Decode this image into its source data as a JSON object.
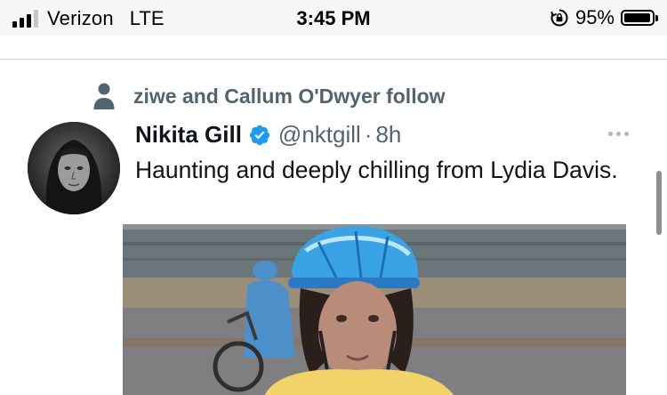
{
  "status_bar": {
    "carrier": "Verizon",
    "network": "LTE",
    "time": "3:45 PM",
    "battery_percent": "95%",
    "battery_level": 0.95,
    "signal_bars": 3
  },
  "social_context": {
    "text": "ziwe and Callum O'Dwyer follow",
    "icon": "person-icon"
  },
  "tweet": {
    "author_name": "Nikita Gill",
    "verified": true,
    "handle": "@nktgill",
    "separator": "·",
    "age": "8h",
    "text": "Haunting and deeply chilling from Lydia Davis.",
    "more_icon": "more-options-icon",
    "media_icon": "photo"
  },
  "colors": {
    "primary_text": "#0f1419",
    "secondary_text": "#536471",
    "verified_blue": "#1d9bf0",
    "status_bar_bg": "#f6f6f6"
  }
}
